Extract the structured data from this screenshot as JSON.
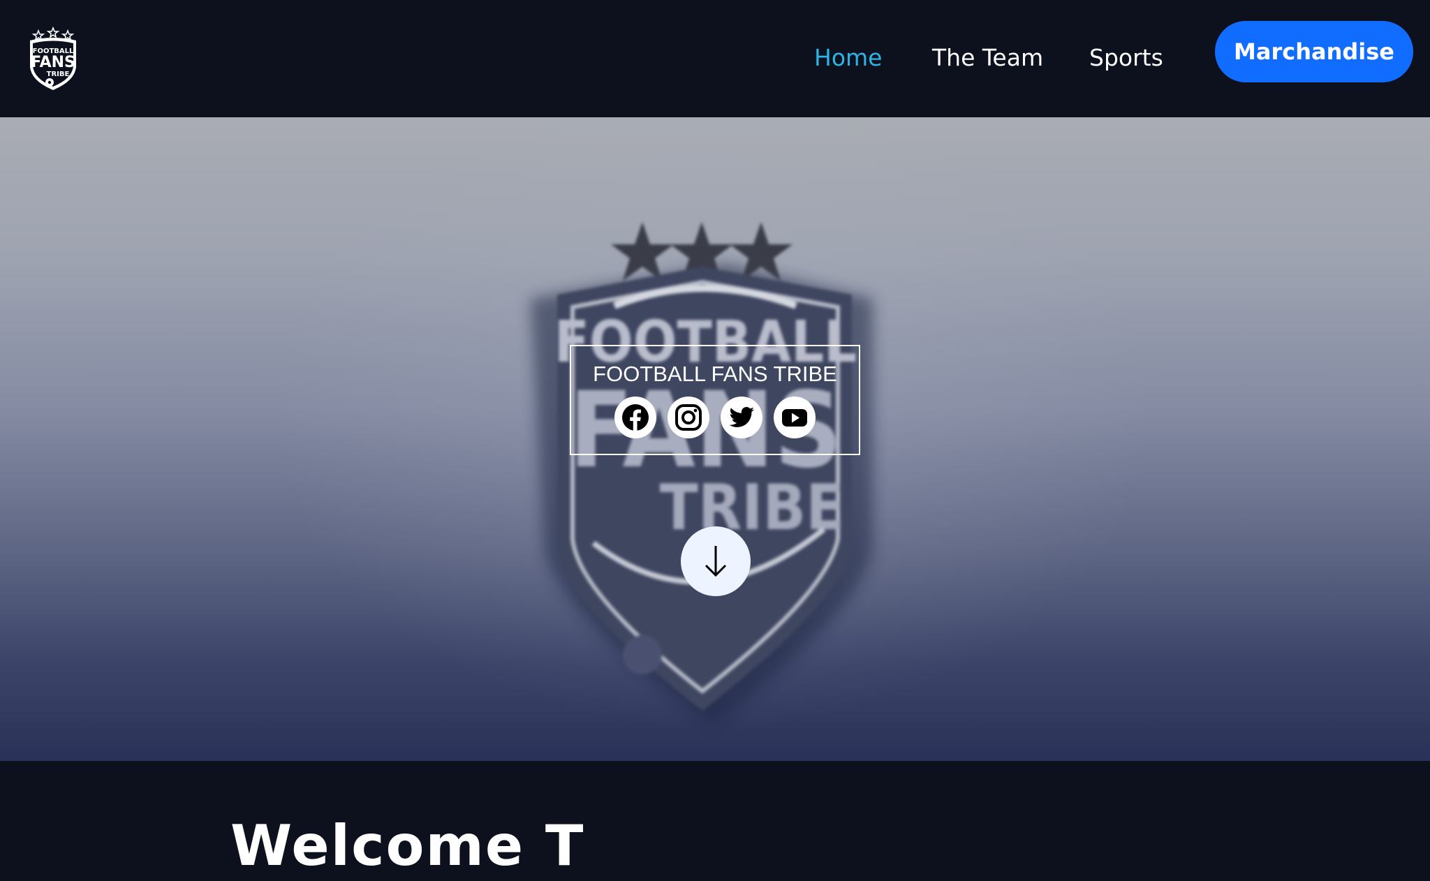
{
  "header": {
    "logo": {
      "line1": "FOOTBALL",
      "line2": "FANS",
      "line3": "TRIBE",
      "icon": "crest-logo-icon"
    },
    "nav": [
      {
        "label": "Home",
        "active": true
      },
      {
        "label": "The Team",
        "active": false
      },
      {
        "label": "Sports",
        "active": false
      }
    ],
    "cta_label": "Marchandise"
  },
  "hero": {
    "crest": {
      "line1": "FOOTBALL",
      "line2": "FANS",
      "line3": "TRIBE"
    },
    "brand_title": "FOOTBALL FANS TRIBE",
    "socials": [
      {
        "icon": "facebook-icon"
      },
      {
        "icon": "instagram-icon"
      },
      {
        "icon": "twitter-icon"
      },
      {
        "icon": "youtube-icon"
      }
    ],
    "scroll_icon": "arrow-down-icon"
  },
  "welcome": {
    "heading_partial": "Welcome T"
  },
  "colors": {
    "background": "#0d111e",
    "nav_active": "#2bb4e5",
    "cta": "#116dff",
    "scroll_button": "#eef4ff"
  }
}
